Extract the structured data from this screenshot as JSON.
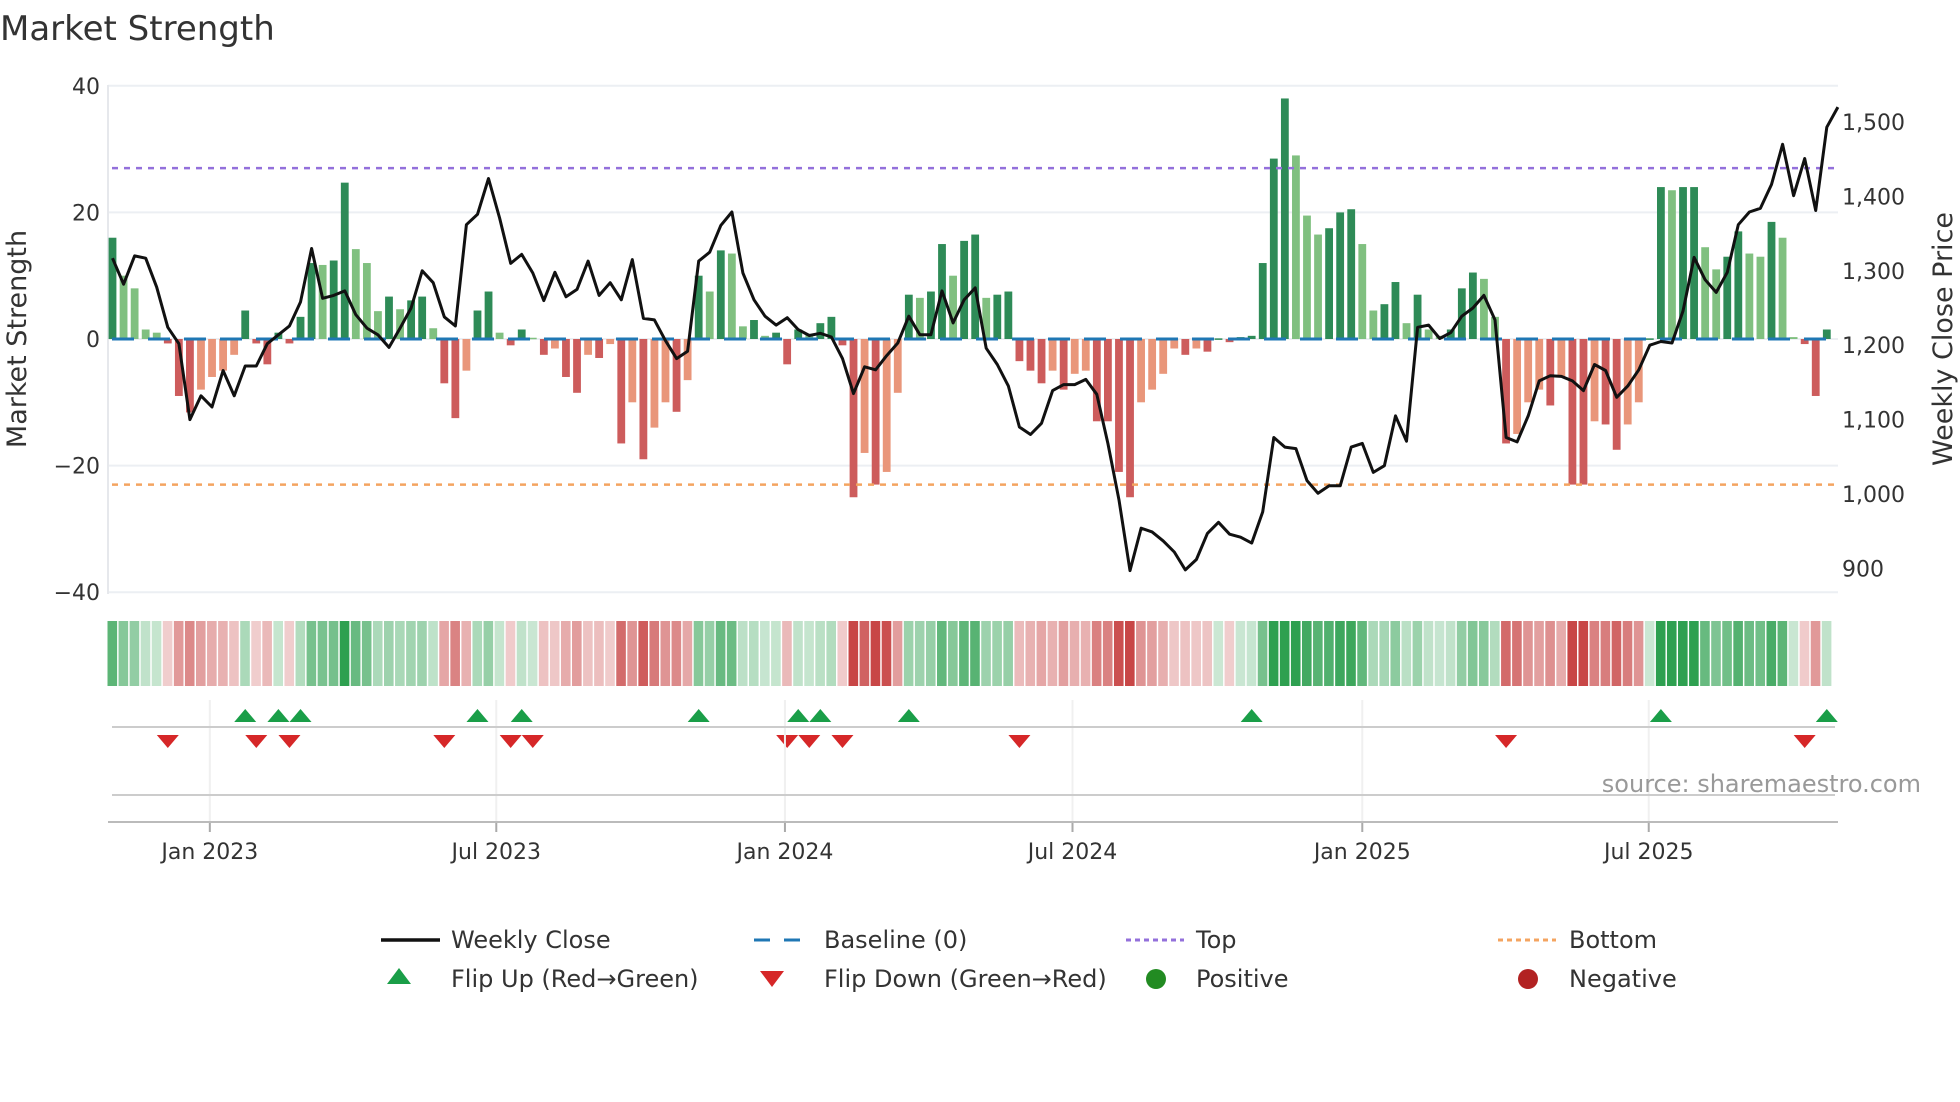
{
  "chart_data": {
    "type": "bar",
    "title": "Market Strength",
    "ylabel": "Market Strength",
    "y2label": "Weekly Close Price",
    "ylim": [
      -40,
      40
    ],
    "y2lim": [
      870,
      1560
    ],
    "y_left_tick_values": [
      40,
      20,
      0,
      -20,
      -40
    ],
    "y_left_tick_labels": [
      "40",
      "20",
      "0",
      "−20",
      "−40"
    ],
    "y_right_tick_values": [
      1500,
      1400,
      1300,
      1200,
      1100,
      1000,
      900
    ],
    "y_right_tick_labels": [
      "1,500",
      "1,400",
      "1,300",
      "1,200",
      "1,100",
      "1,000",
      "900"
    ],
    "x_tick_weeks": [
      8.8,
      34.7,
      60.8,
      86.8,
      113,
      138.9
    ],
    "x_tick_labels": [
      "Jan 2023",
      "Jul 2023",
      "Jan 2024",
      "Jul 2024",
      "Jan 2025",
      "Jul 2025"
    ],
    "top_level": 27,
    "bottom_level": -23,
    "baseline": 0,
    "strength": [
      16,
      10,
      8,
      1.5,
      1,
      -0.7,
      -9,
      -11.6,
      -8,
      -6,
      -5,
      -2.5,
      4.5,
      -0.7,
      -4,
      1,
      -0.7,
      3.5,
      12,
      11.7,
      12.4,
      24.7,
      14.2,
      12,
      4.4,
      6.7,
      4.7,
      6.1,
      6.7,
      1.7,
      -7,
      -12.5,
      -5,
      4.5,
      7.5,
      1,
      -1,
      1.5,
      0.2,
      -2.5,
      -1.5,
      -6,
      -8.5,
      -2.5,
      -3,
      -0.8,
      -16.5,
      -10,
      -19,
      -14,
      -10,
      -11.5,
      -6.5,
      10,
      7.5,
      14,
      13.5,
      2,
      3,
      0.5,
      1,
      -4,
      1.5,
      0.8,
      2.5,
      3.5,
      -1,
      -25,
      -18,
      -23,
      -21,
      -8.5,
      7,
      6.5,
      7.5,
      15,
      10,
      15.5,
      16.5,
      6.5,
      7,
      7.5,
      -3.5,
      -5,
      -7,
      -5,
      -8,
      -5.5,
      -5,
      -13,
      -13,
      -21,
      -25,
      -10,
      -8,
      -5.5,
      -1.5,
      -2.5,
      -1.5,
      -2,
      0.1,
      -0.5,
      0.3,
      0.5,
      12,
      28.5,
      38,
      29,
      19.5,
      16.5,
      17.5,
      20,
      20.5,
      15,
      4.5,
      5.5,
      9,
      2.5,
      7,
      1.5,
      0.5,
      1.5,
      8,
      10.5,
      9.5,
      3.5,
      -16.5,
      -15,
      -10,
      -8,
      -10.5,
      -6,
      -23,
      -23,
      -13,
      -13.5,
      -17.5,
      -13.5,
      -10,
      0.1,
      24,
      23.5,
      24,
      24,
      14.5,
      11,
      13,
      17,
      13.5,
      13,
      18.5,
      16,
      0.3,
      -0.8,
      -9,
      1.5
    ],
    "weekly_close": [
      1317,
      1282,
      1320,
      1317,
      1278,
      1224,
      1202,
      1100,
      1132,
      1117,
      1166,
      1132,
      1172,
      1172,
      1202,
      1214,
      1226,
      1258,
      1330,
      1263,
      1267,
      1273,
      1241,
      1223,
      1214,
      1197,
      1223,
      1250,
      1300,
      1284,
      1238,
      1226,
      1362,
      1376,
      1424,
      1371,
      1310,
      1322,
      1297,
      1260,
      1298,
      1265,
      1275,
      1313,
      1267,
      1284,
      1261,
      1315,
      1236,
      1234,
      1206,
      1182,
      1192,
      1313,
      1325,
      1361,
      1379,
      1297,
      1261,
      1239,
      1227,
      1237,
      1221,
      1213,
      1216,
      1211,
      1182,
      1135,
      1171,
      1167,
      1186,
      1203,
      1239,
      1214,
      1214,
      1273,
      1230,
      1261,
      1277,
      1196,
      1174,
      1145,
      1090,
      1080,
      1095,
      1139,
      1147,
      1147,
      1154,
      1134,
      1068,
      992,
      897,
      954,
      949,
      937,
      922,
      898,
      912,
      947,
      962,
      946,
      942,
      934,
      976,
      1076,
      1063,
      1061,
      1018,
      1001,
      1011,
      1011,
      1063,
      1068,
      1029,
      1038,
      1105,
      1071,
      1224,
      1227,
      1209,
      1217,
      1239,
      1250,
      1267,
      1234,
      1076,
      1070,
      1105,
      1152,
      1159,
      1158,
      1152,
      1139,
      1174,
      1166,
      1130,
      1145,
      1167,
      1200,
      1205,
      1203,
      1246,
      1318,
      1288,
      1271,
      1298,
      1362,
      1379,
      1384,
      1416,
      1470,
      1401,
      1451,
      1381,
      1493,
      1520
    ],
    "flip_up_weeks": [
      12,
      15,
      17,
      33,
      37,
      53,
      62,
      64,
      72,
      103,
      140,
      155
    ],
    "flip_down_weeks": [
      5,
      13,
      16,
      30,
      36,
      38,
      61,
      63,
      66,
      82,
      126,
      153
    ],
    "colors": {
      "pos_strong": "#2e8b57",
      "pos_weak": "#80c080",
      "neg_strong": "#cd5c5c",
      "neg_weak": "#e9967a",
      "baseline": "#1f77b4",
      "top": "#9370db",
      "bottom": "#f4a460",
      "price": "#111111",
      "flip_up": "#1a9e48",
      "flip_down": "#d62728"
    },
    "legend": {
      "weekly_close": "Weekly Close",
      "baseline": "Baseline (0)",
      "top": "Top",
      "bottom": "Bottom",
      "flip_up": "Flip Up (Red→Green)",
      "flip_down": "Flip Down (Green→Red)",
      "positive": "Positive",
      "negative": "Negative"
    },
    "source": "source: sharemaestro.com"
  }
}
